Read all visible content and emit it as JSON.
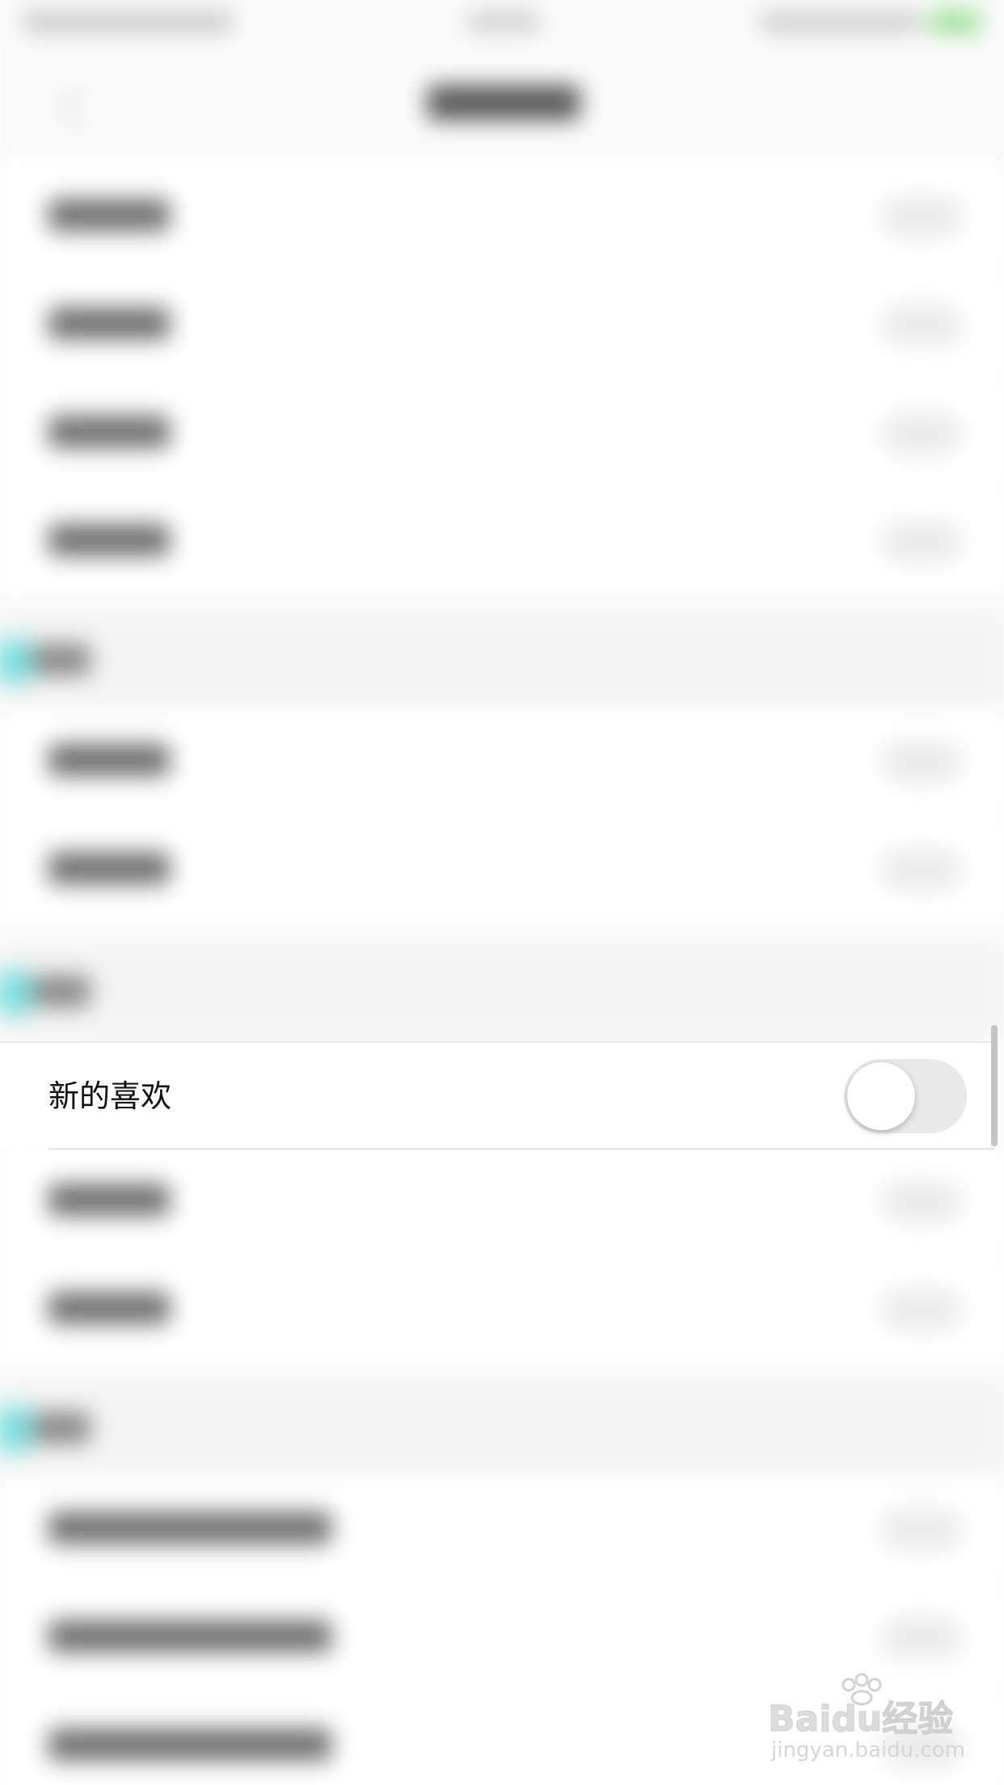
{
  "setting_row": {
    "label": "新的喜欢",
    "toggle_on": false
  },
  "watermark": {
    "brand": "Baidu经验",
    "url": "jingyan.baidu.com"
  }
}
